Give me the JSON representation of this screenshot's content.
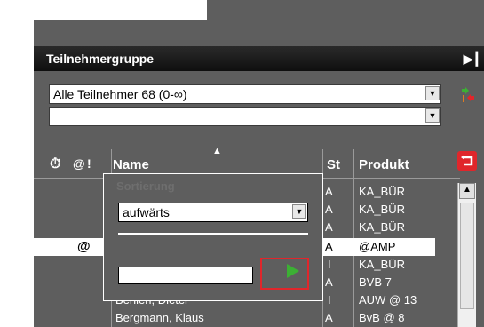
{
  "window": {
    "title": "Teilnehmergruppe",
    "title_icon": "panel-toggle-icon"
  },
  "filter": {
    "group_select": "Alle Teilnehmer 68 (0-∞)",
    "second_select": ""
  },
  "columns": {
    "alarm_icon": "alarm-clock-icon",
    "at": "@",
    "excl": "!",
    "name": "Name",
    "status": "St",
    "product": "Produkt"
  },
  "sort_popup": {
    "title": "Sortierung",
    "direction": "aufwärts",
    "search_value": ""
  },
  "rows": [
    {
      "icon": "",
      "name": "",
      "status": "A",
      "product": "KA_BÜR"
    },
    {
      "icon": "",
      "name": "",
      "status": "A",
      "product": "KA_BÜR"
    },
    {
      "icon": "",
      "name": "",
      "status": "A",
      "product": "KA_BÜR"
    },
    {
      "icon": "@",
      "name": "",
      "status": "A",
      "product": "@AMP"
    },
    {
      "icon": "",
      "name": "",
      "status": "I",
      "product": "KA_BÜR"
    },
    {
      "icon": "",
      "name": "",
      "status": "A",
      "product": "BVB 7"
    },
    {
      "icon": "",
      "name": "Behlen, Dieter",
      "status": "I",
      "product": "AUW @ 13"
    },
    {
      "icon": "",
      "name": "Bergmann, Klaus",
      "status": "A",
      "product": "BvB @ 8"
    }
  ],
  "colors": {
    "panel": "#5e5e5e",
    "title_bar": "#1a1a1a",
    "highlight": "#e0262b",
    "play": "#3cb034"
  }
}
